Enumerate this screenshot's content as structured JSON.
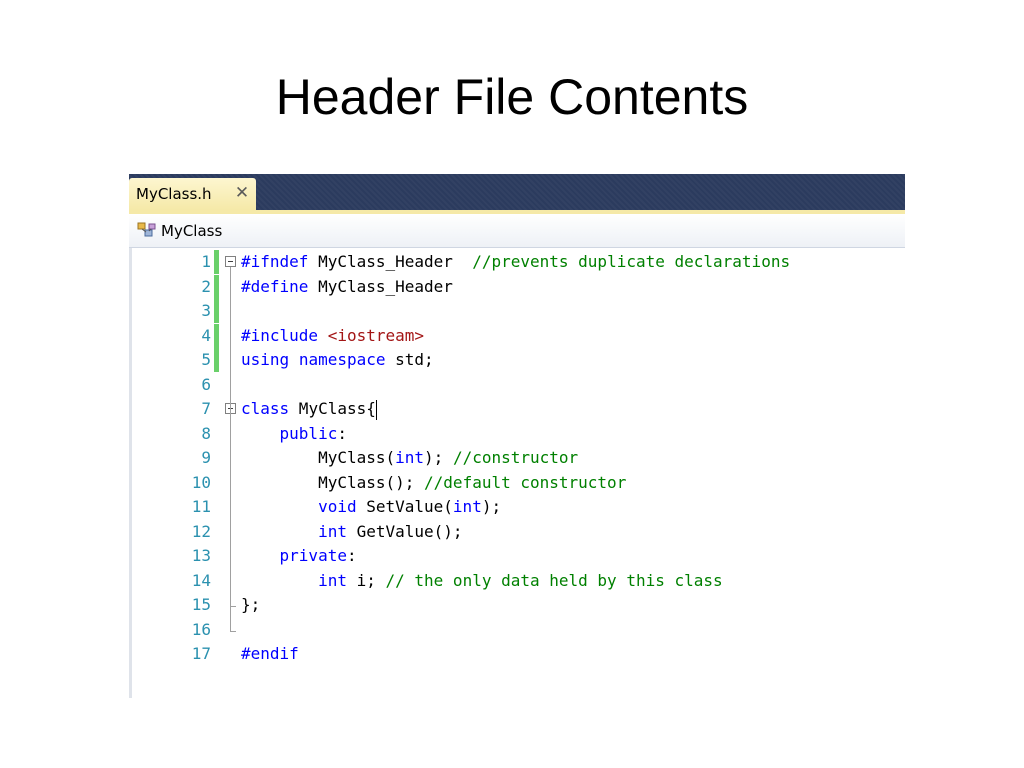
{
  "slide": {
    "title": "Header File Contents"
  },
  "editor": {
    "tab": {
      "label": "MyClass.h",
      "close_glyph": "✕"
    },
    "navigation": {
      "label": "MyClass",
      "icon": "class-icon"
    },
    "colors": {
      "keyword": "#0000ff",
      "comment": "#008000",
      "string": "#a31515",
      "line_number": "#2b91af",
      "change_marker": "#6ad06a",
      "tab_strip": "#2b3b5e",
      "active_tab": "#f5e9a8"
    },
    "lines": [
      {
        "num": "1",
        "tokens": [
          {
            "t": "#ifndef",
            "c": "pp"
          },
          {
            "t": " MyClass_Header  ",
            "c": ""
          },
          {
            "t": "//prevents duplicate declarations",
            "c": "cm"
          }
        ]
      },
      {
        "num": "2",
        "tokens": [
          {
            "t": "#define",
            "c": "pp"
          },
          {
            "t": " MyClass_Header",
            "c": ""
          }
        ]
      },
      {
        "num": "3",
        "tokens": []
      },
      {
        "num": "4",
        "tokens": [
          {
            "t": "#include",
            "c": "pp"
          },
          {
            "t": " ",
            "c": ""
          },
          {
            "t": "<iostream>",
            "c": "st"
          }
        ]
      },
      {
        "num": "5",
        "tokens": [
          {
            "t": "using",
            "c": "kw"
          },
          {
            "t": " ",
            "c": ""
          },
          {
            "t": "namespace",
            "c": "kw"
          },
          {
            "t": " std;",
            "c": ""
          }
        ]
      },
      {
        "num": "6",
        "tokens": []
      },
      {
        "num": "7",
        "tokens": [
          {
            "t": "class",
            "c": "kw"
          },
          {
            "t": " MyClass{",
            "c": ""
          }
        ]
      },
      {
        "num": "8",
        "tokens": [
          {
            "t": "    ",
            "c": ""
          },
          {
            "t": "public",
            "c": "kw"
          },
          {
            "t": ":",
            "c": ""
          }
        ]
      },
      {
        "num": "9",
        "tokens": [
          {
            "t": "        MyClass(",
            "c": ""
          },
          {
            "t": "int",
            "c": "kw"
          },
          {
            "t": "); ",
            "c": ""
          },
          {
            "t": "//constructor",
            "c": "cm"
          }
        ]
      },
      {
        "num": "10",
        "tokens": [
          {
            "t": "        MyClass(); ",
            "c": ""
          },
          {
            "t": "//default constructor",
            "c": "cm"
          }
        ]
      },
      {
        "num": "11",
        "tokens": [
          {
            "t": "        ",
            "c": ""
          },
          {
            "t": "void",
            "c": "kw"
          },
          {
            "t": " SetValue(",
            "c": ""
          },
          {
            "t": "int",
            "c": "kw"
          },
          {
            "t": ");",
            "c": ""
          }
        ]
      },
      {
        "num": "12",
        "tokens": [
          {
            "t": "        ",
            "c": ""
          },
          {
            "t": "int",
            "c": "kw"
          },
          {
            "t": " GetValue();",
            "c": ""
          }
        ]
      },
      {
        "num": "13",
        "tokens": [
          {
            "t": "    ",
            "c": ""
          },
          {
            "t": "private",
            "c": "kw"
          },
          {
            "t": ":",
            "c": ""
          }
        ]
      },
      {
        "num": "14",
        "tokens": [
          {
            "t": "        ",
            "c": ""
          },
          {
            "t": "int",
            "c": "kw"
          },
          {
            "t": " i; ",
            "c": ""
          },
          {
            "t": "// the only data held by this class",
            "c": "cm"
          }
        ]
      },
      {
        "num": "15",
        "tokens": [
          {
            "t": "};",
            "c": ""
          }
        ]
      },
      {
        "num": "16",
        "tokens": []
      },
      {
        "num": "17",
        "tokens": [
          {
            "t": "#endif",
            "c": "pp"
          }
        ]
      }
    ]
  }
}
